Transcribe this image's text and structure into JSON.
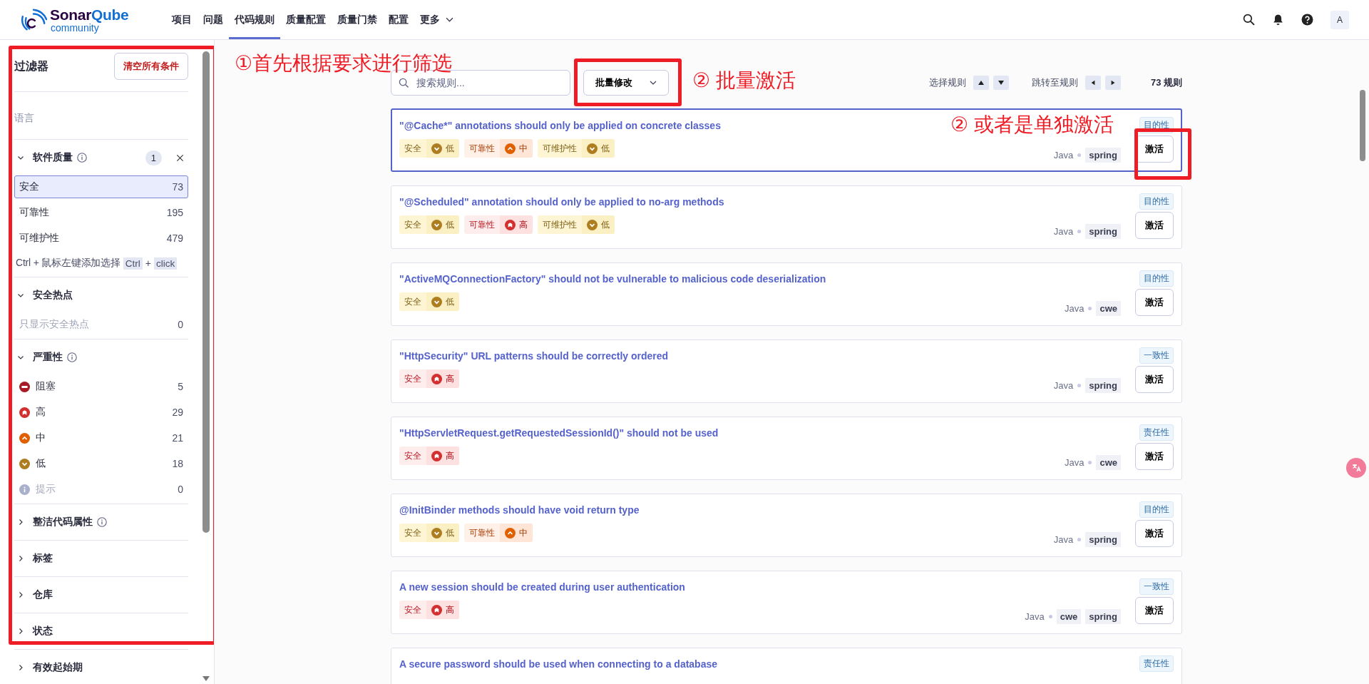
{
  "header": {
    "logo": {
      "word": "Sonar",
      "accent": "Qube",
      "edition": "community"
    },
    "nav": [
      {
        "label": "项目",
        "selected": false,
        "kind": "link"
      },
      {
        "label": "问题",
        "selected": false,
        "kind": "link"
      },
      {
        "label": "代码规则",
        "selected": true,
        "kind": "link"
      },
      {
        "label": "质量配置",
        "selected": false,
        "kind": "link"
      },
      {
        "label": "质量门禁",
        "selected": false,
        "kind": "link"
      },
      {
        "label": "配置",
        "selected": false,
        "kind": "link"
      },
      {
        "label": "更多",
        "selected": false,
        "kind": "dropdown"
      }
    ],
    "avatar": "A"
  },
  "sidebar": {
    "title": "过滤器",
    "clear_button": "清空所有条件",
    "facets": [
      {
        "kind": "plain",
        "label": "语言"
      },
      {
        "kind": "list",
        "label": "软件质量",
        "info": true,
        "expanded": true,
        "count": "1",
        "clearable": true,
        "items": [
          {
            "label": "安全",
            "count": "73",
            "selected": true,
            "disabled": false
          },
          {
            "label": "可靠性",
            "count": "195",
            "selected": false,
            "disabled": false
          },
          {
            "label": "可维护性",
            "count": "479",
            "selected": false,
            "disabled": false
          }
        ],
        "hint": {
          "text": "Ctrl + 鼠标左键添加选择",
          "keys": [
            "Ctrl",
            "click"
          ],
          "joiner": "+"
        }
      },
      {
        "kind": "list",
        "label": "安全热点",
        "expanded": true,
        "items": [
          {
            "label": "只显示安全热点",
            "count": "0",
            "selected": false,
            "disabled": true
          }
        ]
      },
      {
        "kind": "list",
        "label": "严重性",
        "info": true,
        "expanded": true,
        "items": [
          {
            "label": "阻塞",
            "count": "5",
            "kind": "blocker",
            "selected": false,
            "disabled": false
          },
          {
            "label": "高",
            "count": "29",
            "kind": "high",
            "selected": false,
            "disabled": false
          },
          {
            "label": "中",
            "count": "21",
            "kind": "medium",
            "selected": false,
            "disabled": false
          },
          {
            "label": "低",
            "count": "18",
            "kind": "low",
            "selected": false,
            "disabled": false
          },
          {
            "label": "提示",
            "count": "0",
            "kind": "info",
            "selected": false,
            "disabled": true
          }
        ]
      },
      {
        "kind": "list",
        "label": "整洁代码属性",
        "info": true,
        "expanded": false
      },
      {
        "kind": "list",
        "label": "标签",
        "expanded": false
      },
      {
        "kind": "list",
        "label": "仓库",
        "expanded": false
      },
      {
        "kind": "list",
        "label": "状态",
        "expanded": false
      },
      {
        "kind": "list",
        "label": "有效起始期",
        "expanded": false
      }
    ]
  },
  "toolbar": {
    "search": {
      "placeholder": "搜索规则..."
    },
    "bulk_button": "批量修改",
    "select_label": "选择规则",
    "jump_label": "跳转至规则",
    "total": "73 规则"
  },
  "rules": [
    {
      "title": "\"@Cache*\" annotations should only be applied on concrete classes",
      "attribute": "目的性",
      "selected": true,
      "impacts": [
        {
          "quality": "安全",
          "kind": "low",
          "label": "低"
        },
        {
          "quality": "可靠性",
          "kind": "medium",
          "label": "中"
        },
        {
          "quality": "可维护性",
          "kind": "low",
          "label": "低"
        }
      ],
      "language": "Java",
      "tags": [
        "spring"
      ],
      "action": "激活"
    },
    {
      "title": "\"@Scheduled\" annotation should only be applied to no-arg methods",
      "attribute": "目的性",
      "selected": false,
      "impacts": [
        {
          "quality": "安全",
          "kind": "low",
          "label": "低"
        },
        {
          "quality": "可靠性",
          "kind": "high",
          "label": "高"
        },
        {
          "quality": "可维护性",
          "kind": "low",
          "label": "低"
        }
      ],
      "language": "Java",
      "tags": [
        "spring"
      ],
      "action": "激活"
    },
    {
      "title": "\"ActiveMQConnectionFactory\" should not be vulnerable to malicious code deserialization",
      "attribute": "目的性",
      "selected": false,
      "impacts": [
        {
          "quality": "安全",
          "kind": "low",
          "label": "低"
        }
      ],
      "language": "Java",
      "tags": [
        "cwe"
      ],
      "action": "激活"
    },
    {
      "title": "\"HttpSecurity\" URL patterns should be correctly ordered",
      "attribute": "一致性",
      "selected": false,
      "impacts": [
        {
          "quality": "安全",
          "kind": "high",
          "label": "高"
        }
      ],
      "language": "Java",
      "tags": [
        "spring"
      ],
      "action": "激活"
    },
    {
      "title": "\"HttpServletRequest.getRequestedSessionId()\" should not be used",
      "attribute": "责任性",
      "selected": false,
      "impacts": [
        {
          "quality": "安全",
          "kind": "high",
          "label": "高"
        }
      ],
      "language": "Java",
      "tags": [
        "cwe"
      ],
      "action": "激活"
    },
    {
      "title": "@InitBinder methods should have void return type",
      "attribute": "目的性",
      "selected": false,
      "impacts": [
        {
          "quality": "安全",
          "kind": "low",
          "label": "低"
        },
        {
          "quality": "可靠性",
          "kind": "medium",
          "label": "中"
        }
      ],
      "language": "Java",
      "tags": [
        "spring"
      ],
      "action": "激活"
    },
    {
      "title": "A new session should be created during user authentication",
      "attribute": "一致性",
      "selected": false,
      "impacts": [
        {
          "quality": "安全",
          "kind": "high",
          "label": "高"
        }
      ],
      "language": "Java",
      "tags": [
        "cwe",
        "spring"
      ],
      "action": "激活"
    },
    {
      "title": "A secure password should be used when connecting to a database",
      "attribute": "责任性",
      "selected": false
    }
  ],
  "annotations": [
    {
      "kind": "filters",
      "text": "①首先根据要求进行筛选"
    },
    {
      "kind": "bulk",
      "text": "② 批量激活"
    },
    {
      "kind": "activate",
      "text": "② 或者是单独激活"
    }
  ]
}
